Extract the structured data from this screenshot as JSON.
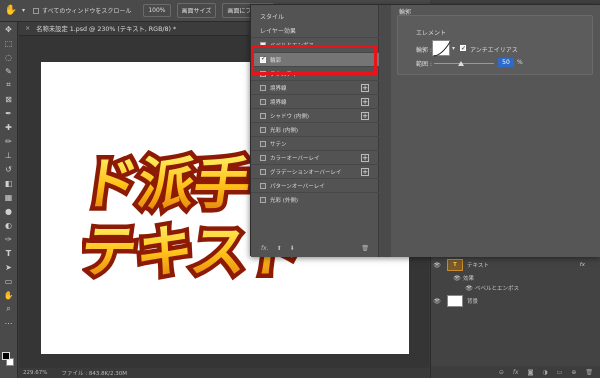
{
  "options_bar": {
    "scroll_all_label": "すべてのウィンドウをスクロール",
    "zoom_btn": "100%",
    "fit_screen_btn": "画面サイズ",
    "fill_screen_btn": "画面にフィット"
  },
  "document": {
    "tab_title": "名称未設定 1.psd @ 230% (テキスト, RGB/8) *",
    "artwork_line1": "ド派手",
    "artwork_line2": "テキスト"
  },
  "status": {
    "zoom": "229.67%",
    "file_info": "ファイル : 843.8K/2.30M"
  },
  "layer_style": {
    "style_header": "スタイル",
    "effects_header": "レイヤー効果",
    "items": [
      {
        "label": "ベベルとエンボス",
        "checked": true
      },
      {
        "label": "輪郭",
        "checked": true,
        "selected": true
      },
      {
        "label": "テクスチャ",
        "checked": false
      },
      {
        "label": "境界線",
        "checked": false,
        "has_plus": true
      },
      {
        "label": "境界線",
        "checked": false,
        "has_plus": true
      },
      {
        "label": "シャドウ (内側)",
        "checked": false,
        "has_plus": true
      },
      {
        "label": "光彩 (内側)",
        "checked": false
      },
      {
        "label": "サテン",
        "checked": false
      },
      {
        "label": "カラーオーバーレイ",
        "checked": false,
        "has_plus": true
      },
      {
        "label": "グラデーションオーバーレイ",
        "checked": false,
        "has_plus": true
      },
      {
        "label": "パターンオーバーレイ",
        "checked": false
      },
      {
        "label": "光彩 (外側)",
        "checked": false
      }
    ],
    "footer_fx": "fx.",
    "contour_panel": {
      "section_title": "輪郭",
      "subsection_title": "エレメント",
      "contour_label": "輪郭 :",
      "antialias_label": "アンチエイリアス",
      "range_label": "範囲 :",
      "range_value": "50",
      "range_unit": "%"
    }
  },
  "layers_panel": {
    "layers": [
      {
        "name": "テキスト",
        "type": "text",
        "fx": "fx"
      },
      {
        "name": "効果",
        "type": "effects-header"
      },
      {
        "name": "ベベルとエンボス",
        "type": "effect"
      },
      {
        "name": "背景",
        "type": "background"
      }
    ]
  },
  "colors": {
    "highlight": "#e8141a",
    "selected_item": "#757575",
    "number_field": "#2e6bc9"
  }
}
